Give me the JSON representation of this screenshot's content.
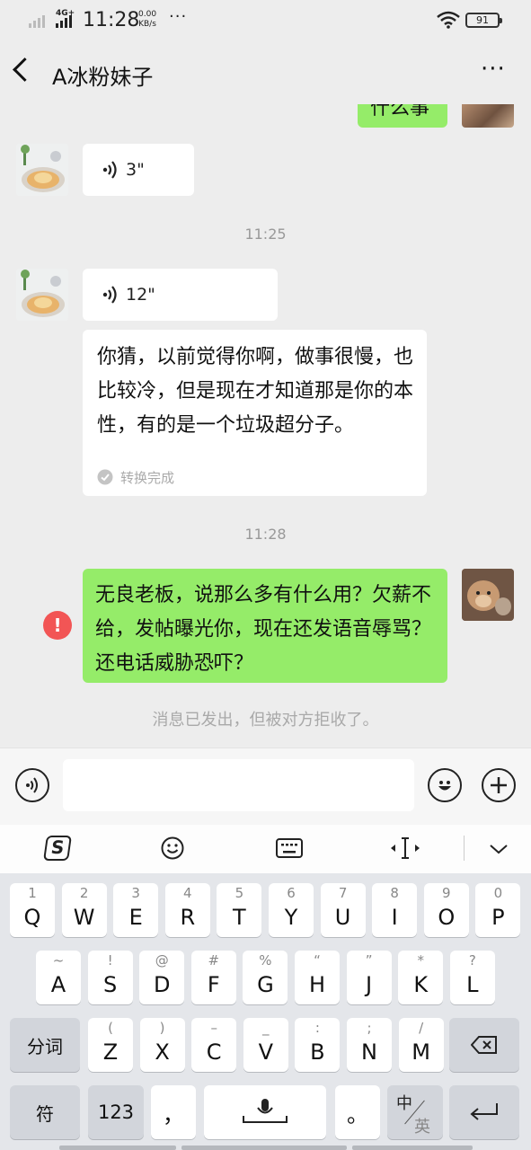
{
  "status_bar": {
    "network": "4G+",
    "time": "11:28",
    "speed_value": "0.00",
    "speed_unit": "KB/s",
    "dots": "···",
    "battery": "91"
  },
  "header": {
    "title": "A冰粉妹子",
    "more": "···"
  },
  "chat": {
    "top_partial_text": "什么事",
    "voice_1": "3\"",
    "timestamp_1": "11:25",
    "voice_2": "12\"",
    "transcript": "你猜，以前觉得你啊，做事很慢，也比较冷，但是现在才知道那是你的本性，有的是一个垃圾超分子。",
    "transcript_status": "转换完成",
    "timestamp_2": "11:28",
    "sent_message": "无良老板，说那么多有什么用？欠薪不给，发帖曝光你，现在还发语音辱骂？还电话威胁恐吓？",
    "error_mark": "!",
    "rejected_notice": "消息已发出，但被对方拒收了。"
  },
  "keyboard": {
    "row1": [
      {
        "main": "Q",
        "sub": "1"
      },
      {
        "main": "W",
        "sub": "2"
      },
      {
        "main": "E",
        "sub": "3"
      },
      {
        "main": "R",
        "sub": "4"
      },
      {
        "main": "T",
        "sub": "5"
      },
      {
        "main": "Y",
        "sub": "6"
      },
      {
        "main": "U",
        "sub": "7"
      },
      {
        "main": "I",
        "sub": "8"
      },
      {
        "main": "O",
        "sub": "9"
      },
      {
        "main": "P",
        "sub": "0"
      }
    ],
    "row2": [
      {
        "main": "A",
        "sub": "~"
      },
      {
        "main": "S",
        "sub": "!"
      },
      {
        "main": "D",
        "sub": "@"
      },
      {
        "main": "F",
        "sub": "#"
      },
      {
        "main": "G",
        "sub": "%"
      },
      {
        "main": "H",
        "sub": "“"
      },
      {
        "main": "J",
        "sub": "”"
      },
      {
        "main": "K",
        "sub": "*"
      },
      {
        "main": "L",
        "sub": "?"
      }
    ],
    "row3": [
      {
        "main": "Z",
        "sub": "("
      },
      {
        "main": "X",
        "sub": ")"
      },
      {
        "main": "C",
        "sub": "–"
      },
      {
        "main": "V",
        "sub": "_"
      },
      {
        "main": "B",
        "sub": ":"
      },
      {
        "main": "N",
        "sub": ";"
      },
      {
        "main": "M",
        "sub": "/"
      }
    ],
    "fenci": "分词",
    "fu": "符",
    "num": "123",
    "comma": "，",
    "period": "。",
    "zh": "中",
    "en": "英"
  }
}
